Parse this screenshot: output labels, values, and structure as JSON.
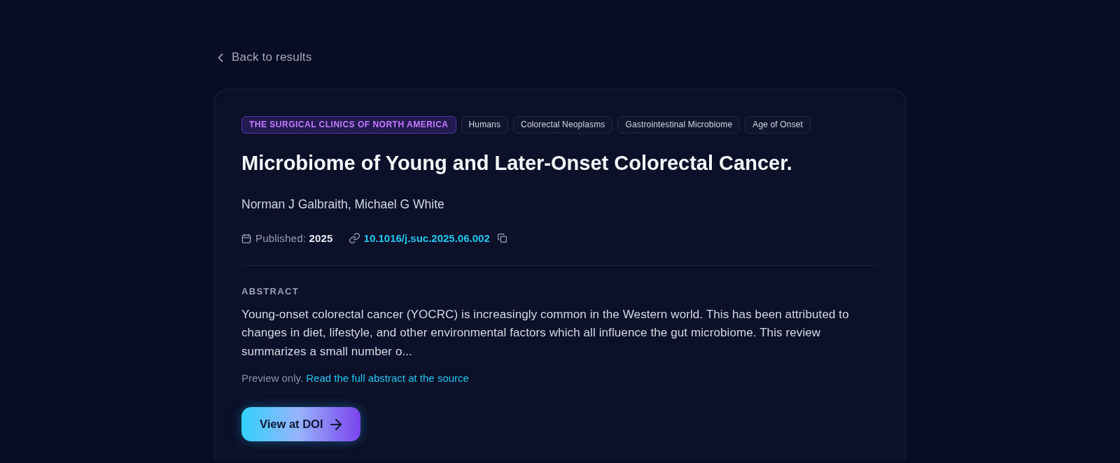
{
  "back_link": {
    "label": "Back to results"
  },
  "article": {
    "journal": "THE SURGICAL CLINICS OF NORTH AMERICA",
    "tags": [
      "Humans",
      "Colorectal Neoplasms",
      "Gastrointestinal Microbiome",
      "Age of Onset"
    ],
    "title": "Microbiome of Young and Later-Onset Colorectal Cancer.",
    "authors": "Norman J Galbraith, Michael G White",
    "published": "Published: **2025**",
    "doi": "10.1016/j.suc.2025.06.002",
    "abstract": {
      "heading": "ABSTRACT",
      "text": "Young-onset colorectal cancer (YOCRC) is increasingly common in the Western world. This has been attributed to changes in diet, lifestyle, and other environmental factors which all influence the gut microbiome. This review summarizes a small number o...",
      "preview_note": "Preview only.",
      "source_link": "Read the full abstract at the source"
    },
    "button": {
      "label": "View at DOI"
    }
  }
}
